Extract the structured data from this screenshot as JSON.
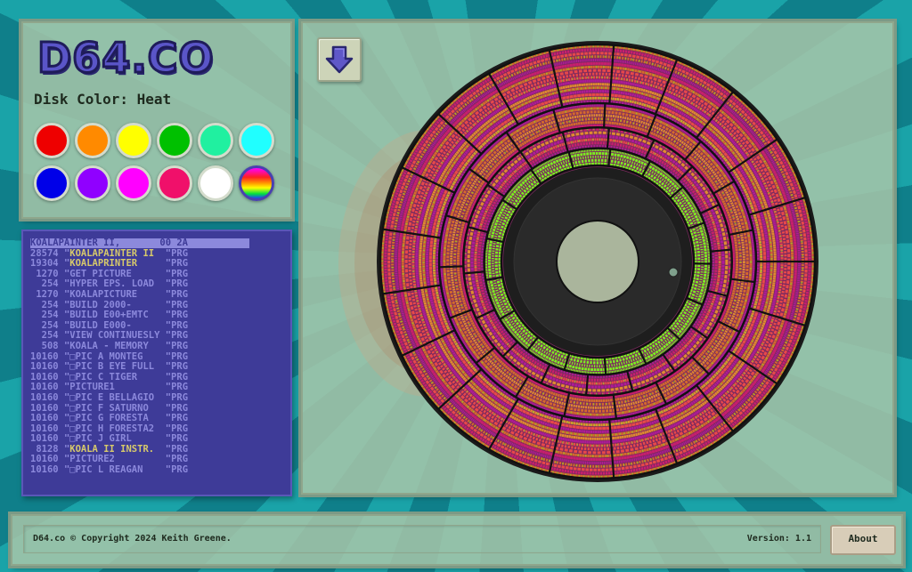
{
  "logo": {
    "text": "D64.CO"
  },
  "disk_color": {
    "label": "Disk Color: Heat",
    "selected": "Heat"
  },
  "swatches": [
    {
      "name": "red",
      "color": "#ee0000"
    },
    {
      "name": "orange",
      "color": "#ff8a00"
    },
    {
      "name": "yellow",
      "color": "#ffff00"
    },
    {
      "name": "green",
      "color": "#00c000"
    },
    {
      "name": "mint",
      "color": "#20f0a0"
    },
    {
      "name": "cyan",
      "color": "#20ffff"
    },
    {
      "name": "blue",
      "color": "#0000e8"
    },
    {
      "name": "violet",
      "color": "#9000ff"
    },
    {
      "name": "magenta",
      "color": "#ff00ff"
    },
    {
      "name": "pink",
      "color": "#f0106a"
    },
    {
      "name": "white",
      "color": "#ffffff"
    },
    {
      "name": "heat",
      "color": "rainbow"
    }
  ],
  "download_button": {
    "icon": "download-arrow-icon"
  },
  "directory": {
    "header": "KOALAPAINTER II,       00 2A",
    "rows": [
      {
        "size": "28574",
        "name": "\"KOALAPAINTER II",
        "type": "\"PRG",
        "highlight": true
      },
      {
        "size": "19304",
        "name": "\"KOALAPRINTER",
        "type": "\"PRG",
        "highlight": true
      },
      {
        "size": " 1270",
        "name": "\"GET PICTURE",
        "type": "\"PRG",
        "highlight": false
      },
      {
        "size": "  254",
        "name": "\"HYPER EPS. LOAD",
        "type": "\"PRG",
        "highlight": false
      },
      {
        "size": " 1270",
        "name": "\"KOALAPICTURE",
        "type": "\"PRG",
        "highlight": false
      },
      {
        "size": "  254",
        "name": "\"BUILD 2000-",
        "type": "\"PRG",
        "highlight": false
      },
      {
        "size": "  254",
        "name": "\"BUILD E00+EMTC",
        "type": "\"PRG",
        "highlight": false
      },
      {
        "size": "  254",
        "name": "\"BUILD E000-",
        "type": "\"PRG",
        "highlight": false
      },
      {
        "size": "  254",
        "name": "\"VIEW CONTINUESLY",
        "type": "\"PRG",
        "highlight": false
      },
      {
        "size": "  508",
        "name": "\"KOALA - MEMORY",
        "type": "\"PRG",
        "highlight": false
      },
      {
        "size": "10160",
        "name": "\"□PIC A MONTEG",
        "type": "\"PRG",
        "highlight": false
      },
      {
        "size": "10160",
        "name": "\"□PIC B EYE FULL",
        "type": "\"PRG",
        "highlight": false
      },
      {
        "size": "10160",
        "name": "\"□PIC C TIGER",
        "type": "\"PRG",
        "highlight": false
      },
      {
        "size": "10160",
        "name": "\"PICTURE1",
        "type": "\"PRG",
        "highlight": false
      },
      {
        "size": "10160",
        "name": "\"□PIC E BELLAGIO",
        "type": "\"PRG",
        "highlight": false
      },
      {
        "size": "10160",
        "name": "\"□PIC F SATURNO",
        "type": "\"PRG",
        "highlight": false
      },
      {
        "size": "10160",
        "name": "\"□PIC G FORESTA",
        "type": "\"PRG",
        "highlight": false
      },
      {
        "size": "10160",
        "name": "\"□PIC H FORESTA2",
        "type": "\"PRG",
        "highlight": false
      },
      {
        "size": "10160",
        "name": "\"□PIC J GIRL",
        "type": "\"PRG",
        "highlight": false
      },
      {
        "size": " 8128",
        "name": "\"KOALA II INSTR.",
        "type": "\"PRG",
        "highlight": true
      },
      {
        "size": "10160",
        "name": "\"PICTURE2",
        "type": "\"PRG",
        "highlight": false
      },
      {
        "size": "10160",
        "name": "\"□PIC L REAGAN",
        "type": "\"PRG",
        "highlight": false
      }
    ]
  },
  "footer": {
    "copyright": "D64.co © Copyright 2024 Keith Greene.",
    "version": "Version: 1.1",
    "about_label": "About"
  },
  "disk": {
    "colors": [
      "#e8484a",
      "#c81e6e",
      "#d46a2c",
      "#b01a9a",
      "#e08a30"
    ],
    "inner_color": "#7cf020",
    "hub_color": "#1e1e1e"
  }
}
